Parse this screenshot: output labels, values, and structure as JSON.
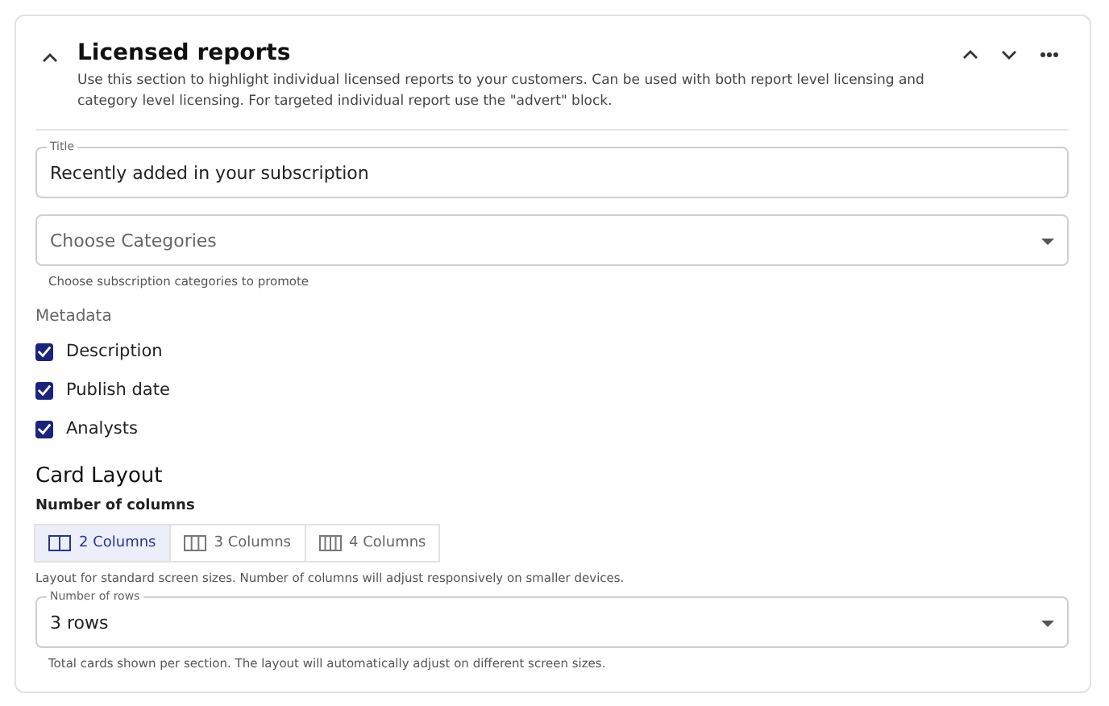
{
  "section": {
    "title": "Licensed reports",
    "expanded": true,
    "description": "Use this section to highlight individual licensed reports to your customers. Can be used with both report level licensing and category level licensing. For targeted individual report use the \"advert\" block."
  },
  "title_field": {
    "label": "Title",
    "value": "Recently added in your subscription"
  },
  "categories_field": {
    "placeholder": "Choose Categories",
    "helper": "Choose subscription categories to promote"
  },
  "metadata": {
    "label": "Metadata",
    "options": [
      {
        "label": "Description",
        "checked": true
      },
      {
        "label": "Publish date",
        "checked": true
      },
      {
        "label": "Analysts",
        "checked": true
      }
    ]
  },
  "card_layout": {
    "heading": "Card Layout",
    "columns_label": "Number of columns",
    "columns": [
      {
        "label": "2 Columns",
        "selected": true
      },
      {
        "label": "3 Columns",
        "selected": false
      },
      {
        "label": "4 Columns",
        "selected": false
      }
    ],
    "columns_helper": "Layout for standard screen sizes. Number of columns will adjust responsively on smaller devices.",
    "rows_field": {
      "label": "Number of rows",
      "value": "3 rows",
      "helper": "Total cards shown per section. The layout will automatically adjust on different screen sizes."
    }
  }
}
